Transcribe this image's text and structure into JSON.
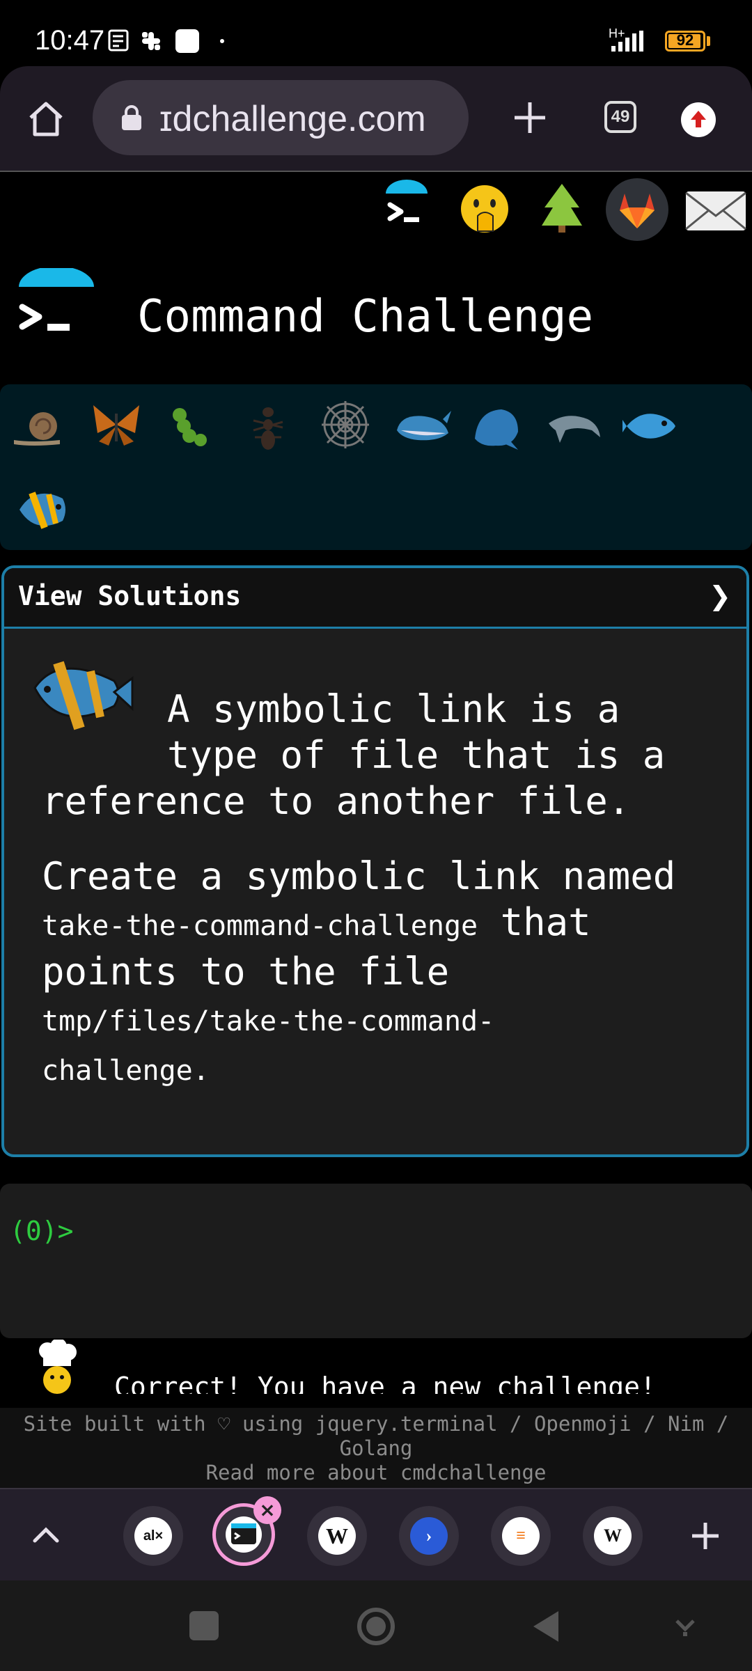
{
  "status_bar": {
    "time": "10:47",
    "network": "H+",
    "battery": "92"
  },
  "browser": {
    "url": "ɪdchallenge.com",
    "tab_count": "49"
  },
  "site": {
    "title": "Command Challenge"
  },
  "solutions_panel": {
    "title": "View Solutions",
    "chevron": "❯",
    "para1_line1": "A symbolic link is a",
    "para1_line2": "type of file that is a",
    "para1_line3": "reference to another file.",
    "para2_a": "Create a symbolic link named",
    "para2_code1": "take-the-command-challenge",
    "para2_b": " that",
    "para2_c": "points to the file",
    "para2_code2a": "tmp/files/take-the-command-",
    "para2_code2b": "challenge",
    "para2_end": "."
  },
  "terminal": {
    "prompt": "(0)>"
  },
  "message": {
    "text": "Correct! You have a new challenge!"
  },
  "footer": {
    "line1": "Site built with ♡ using jquery.terminal / Openmoji / Nim /",
    "line2": "Golang",
    "line3": "Read more about cmdchallenge"
  },
  "tab_strip": {
    "tabs": [
      "al×",
      "terminal",
      "W",
      "blue",
      "stack",
      "W"
    ]
  },
  "icons": {
    "home": "home-icon",
    "lock": "lock-icon",
    "add": "plus-icon",
    "update": "arrow-up-icon"
  },
  "colors": {
    "accent_blue": "#1d7fa8",
    "prompt_green": "#2ecc40",
    "umbrella_cyan": "#1ab8e8",
    "browser_bg": "#1f1a24"
  }
}
